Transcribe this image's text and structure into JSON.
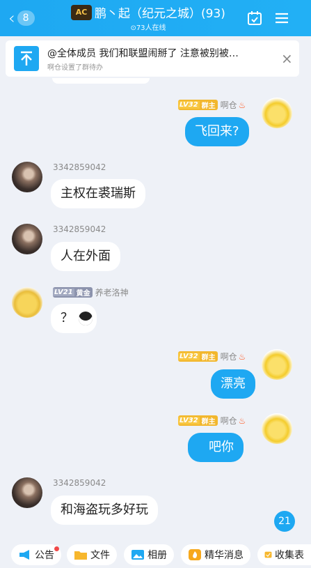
{
  "header": {
    "back_count": "8",
    "logo_text": "AC",
    "title": "鹏丶起（纪元之城）(93)",
    "online": "⊙73人在线"
  },
  "notice": {
    "text": "@全体成员 我们和联盟闹掰了  注意被别被…",
    "sub": "啊仓设置了群待办"
  },
  "badges": {
    "owner": {
      "level": "LV32",
      "role": "群主"
    },
    "gold": {
      "level": "LV21",
      "role": "黄金"
    }
  },
  "messages": [
    {
      "sender": "啊仓",
      "text": "飞回来?"
    },
    {
      "sender": "3342859042",
      "text": "主权在裘瑞斯"
    },
    {
      "sender": "3342859042",
      "text": "人在外面"
    },
    {
      "sender": "养老洛神",
      "text": "？"
    },
    {
      "sender": "啊仓",
      "text": "漂亮"
    },
    {
      "sender": "啊仓",
      "text": "吧你"
    },
    {
      "sender": "3342859042",
      "text": "和海盗玩多好玩"
    }
  ],
  "unread_count": "21",
  "toolbar": {
    "announce": "公告",
    "files": "文件",
    "album": "相册",
    "essence": "精华消息",
    "collect": "收集表"
  },
  "colors": {
    "accent": "#1ea8f2",
    "background": "#eef1f7",
    "owner_badge": "#f2b72d",
    "gold_badge": "#8c93ad"
  }
}
